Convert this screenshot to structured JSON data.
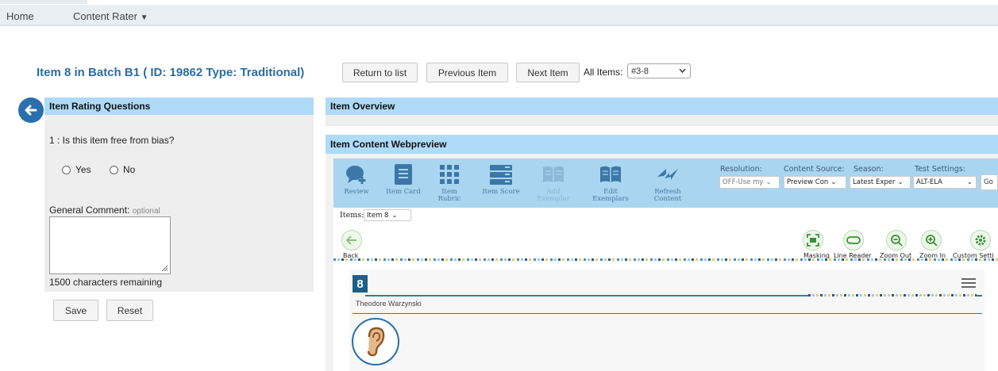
{
  "nav": {
    "home": "Home",
    "content_rater": "Content Rater",
    "dropdown_arrow": "▼"
  },
  "title": "Item 8 in Batch B1 ( ID: 19862 Type: Traditional)",
  "buttons": {
    "return": "Return to list",
    "previous": "Previous Item",
    "next": "Next Item",
    "save": "Save",
    "reset": "Reset"
  },
  "all_items": {
    "label": "All Items:",
    "value": "#3-8"
  },
  "left": {
    "header": "Item Rating Questions",
    "question": "1 : Is this item free from bias?",
    "yes": "Yes",
    "no": "No",
    "comment_label": "General Comment:",
    "comment_optional": "optional",
    "remaining": "1500 characters remaining"
  },
  "right": {
    "overview_header": "Item Overview",
    "webpreview_header": "Item Content Webpreview"
  },
  "toolbar": {
    "tools": [
      {
        "label": "Review",
        "icon": "review-chat-icon"
      },
      {
        "label": "Item Card",
        "icon": "item-card-icon"
      },
      {
        "label": "Item Rubric",
        "icon": "item-rubric-icon"
      },
      {
        "label": "Item Score",
        "icon": "item-score-icon"
      },
      {
        "label": "Add Exemplar",
        "icon": "add-exemplar-icon"
      },
      {
        "label": "Edit Exemplars",
        "icon": "edit-exemplars-icon"
      },
      {
        "label": "Refresh Content",
        "icon": "refresh-content-icon"
      }
    ],
    "resolution_label": "Resolution:",
    "resolution_value": "OFF-Use my",
    "content_source_label": "Content Source:",
    "content_source_value": "Preview Con",
    "season_label": "Season:",
    "season_value": "Latest Exper",
    "test_settings_label": "Test Settings:",
    "test_settings_value": "ALT-ELA",
    "go": "Go"
  },
  "items_select": {
    "label": "Items:",
    "value": "Item 8"
  },
  "content_tools": {
    "back": "Back",
    "masking": "Masking",
    "line_reader": "Line Reader",
    "zoom_out": "Zoom Out",
    "zoom_in": "Zoom In",
    "custom_settings": "Custom Setti"
  },
  "item_card": {
    "number": "8",
    "author": "Theodore Warzynski"
  },
  "colors": {
    "accent": "#2a6ea3",
    "header_bg": "#aedbf7",
    "toolbar_bg": "#a9d5f0"
  }
}
